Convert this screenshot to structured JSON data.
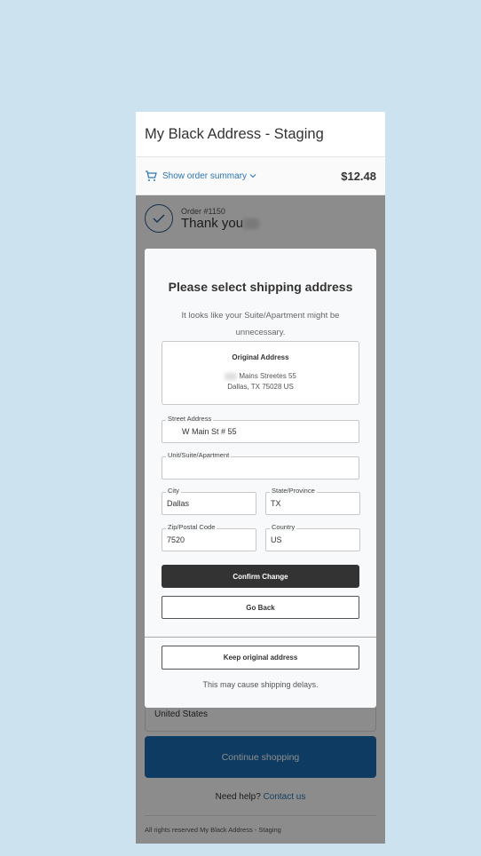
{
  "store": {
    "title": "My Black Address - Staging"
  },
  "summary_bar": {
    "link_label": "Show order summary",
    "total": "$12.48"
  },
  "confirmation": {
    "order_number": "Order #1150",
    "thank_you": "Thank you"
  },
  "background": {
    "country_value": "United States",
    "continue_label": "Continue shopping",
    "help_text": "Need help?",
    "help_link": "Contact us",
    "footer": "All rights reserved My Black Address - Staging"
  },
  "modal": {
    "title": "Please select shipping address",
    "description": "It looks like your Suite/Apartment might be unnecessary.",
    "original": {
      "heading": "Original Address",
      "line1": "Mains Streetes 55",
      "line2": "Dallas, TX 75028 US"
    },
    "fields": {
      "street": {
        "label": "Street Address",
        "value": "W Main St # 55"
      },
      "unit": {
        "label": "Unit/Suite/Apartment",
        "value": ""
      },
      "city": {
        "label": "City",
        "value": "Dallas"
      },
      "state": {
        "label": "State/Province",
        "value": "TX"
      },
      "zip": {
        "label": "Zip/Postal Code",
        "value": "7520"
      },
      "country": {
        "label": "Country",
        "value": "US"
      }
    },
    "confirm_label": "Confirm Change",
    "goback_label": "Go Back",
    "keep_label": "Keep original address",
    "delay_note": "This may cause shipping delays."
  },
  "icons": {
    "cart": "cart-icon",
    "chevron": "chevron-down-icon",
    "check": "check-circle-icon"
  }
}
